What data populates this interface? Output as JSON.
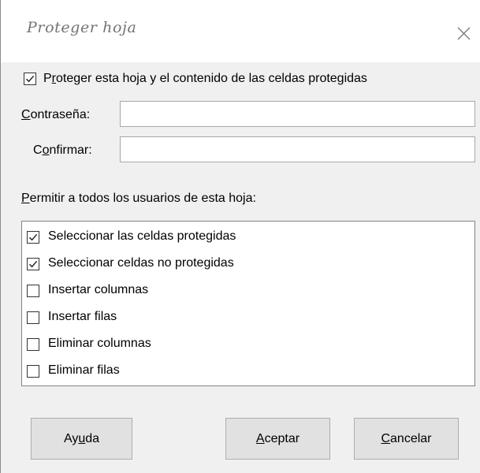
{
  "window": {
    "title": "Proteger hoja"
  },
  "protect_sheet": {
    "checked": true,
    "label_pre": "P",
    "label_mnemonic": "r",
    "label_post": "oteger esta hoja y el contenido de las celdas protegidas"
  },
  "password": {
    "label_mnemonic": "C",
    "label_post": "ontraseña:",
    "value": ""
  },
  "confirm": {
    "label_pre": "C",
    "label_mnemonic": "o",
    "label_post": "nfirmar:",
    "value": ""
  },
  "permissions": {
    "heading_mnemonic": "P",
    "heading_post": "ermitir a todos los usuarios de esta hoja:",
    "items": [
      {
        "label": "Seleccionar las celdas protegidas",
        "checked": true
      },
      {
        "label": "Seleccionar celdas no protegidas",
        "checked": true
      },
      {
        "label": "Insertar columnas",
        "checked": false
      },
      {
        "label": "Insertar filas",
        "checked": false
      },
      {
        "label": "Eliminar columnas",
        "checked": false
      },
      {
        "label": "Eliminar filas",
        "checked": false
      }
    ]
  },
  "buttons": {
    "help": {
      "pre": "Ay",
      "mnemonic": "u",
      "post": "da"
    },
    "ok": {
      "pre": "",
      "mnemonic": "A",
      "post": "ceptar"
    },
    "cancel": {
      "pre": "",
      "mnemonic": "C",
      "post": "ancelar"
    }
  },
  "icons": {
    "close": "close-icon",
    "check": "check-icon"
  }
}
